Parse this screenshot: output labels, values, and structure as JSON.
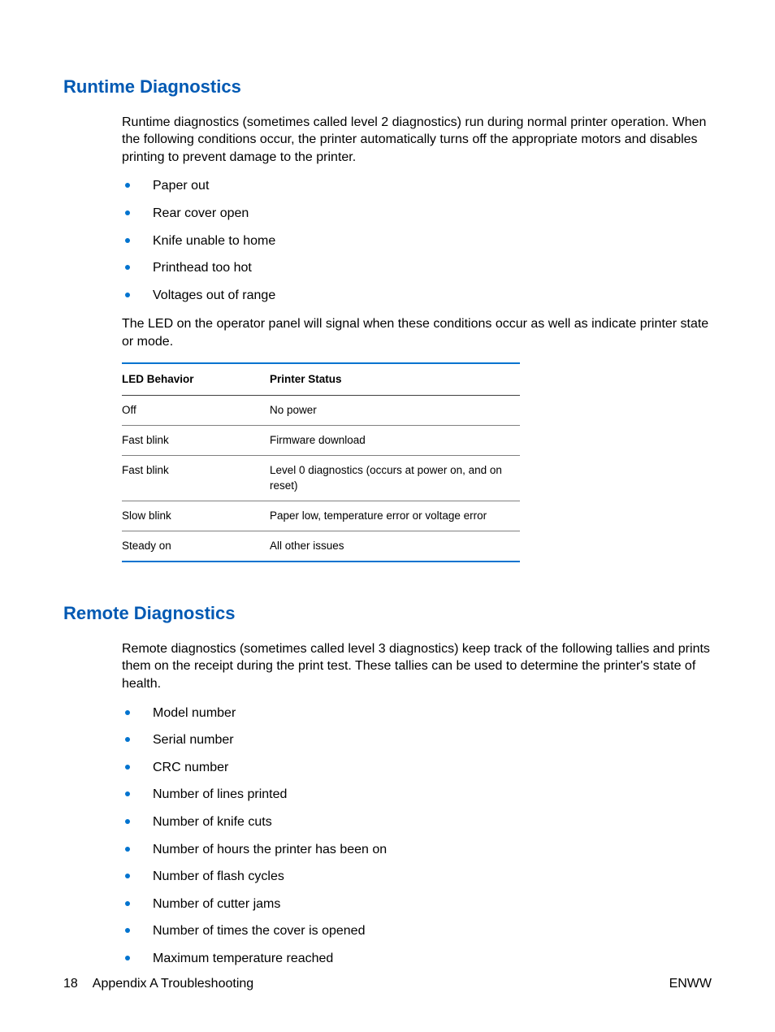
{
  "section1": {
    "heading": "Runtime Diagnostics",
    "intro": "Runtime diagnostics (sometimes called level 2 diagnostics) run during normal printer operation. When the following conditions occur, the printer automatically turns off the appropriate motors and disables printing to prevent damage to the printer.",
    "bullets": [
      "Paper out",
      "Rear cover open",
      "Knife unable to home",
      "Printhead too hot",
      "Voltages out of range"
    ],
    "after": "The LED on the operator panel will signal when these conditions occur as well as indicate printer state or mode.",
    "table": {
      "headers": [
        "LED Behavior",
        "Printer Status"
      ],
      "rows": [
        [
          "Off",
          "No power"
        ],
        [
          "Fast blink",
          "Firmware download"
        ],
        [
          "Fast blink",
          "Level 0 diagnostics (occurs at power on, and on reset)"
        ],
        [
          "Slow blink",
          "Paper low, temperature error or voltage error"
        ],
        [
          "Steady on",
          "All other issues"
        ]
      ]
    }
  },
  "section2": {
    "heading": "Remote Diagnostics",
    "intro": "Remote diagnostics (sometimes called level 3 diagnostics) keep track of the following tallies and prints them on the receipt during the print test. These tallies can be used to determine the printer's state of health.",
    "bullets": [
      "Model number",
      "Serial number",
      "CRC number",
      "Number of lines printed",
      "Number of knife cuts",
      "Number of hours the printer has been on",
      "Number of flash cycles",
      "Number of cutter jams",
      "Number of times the cover is opened",
      "Maximum temperature reached"
    ]
  },
  "footer": {
    "page": "18",
    "appendix": "Appendix A   Troubleshooting",
    "right": "ENWW"
  }
}
